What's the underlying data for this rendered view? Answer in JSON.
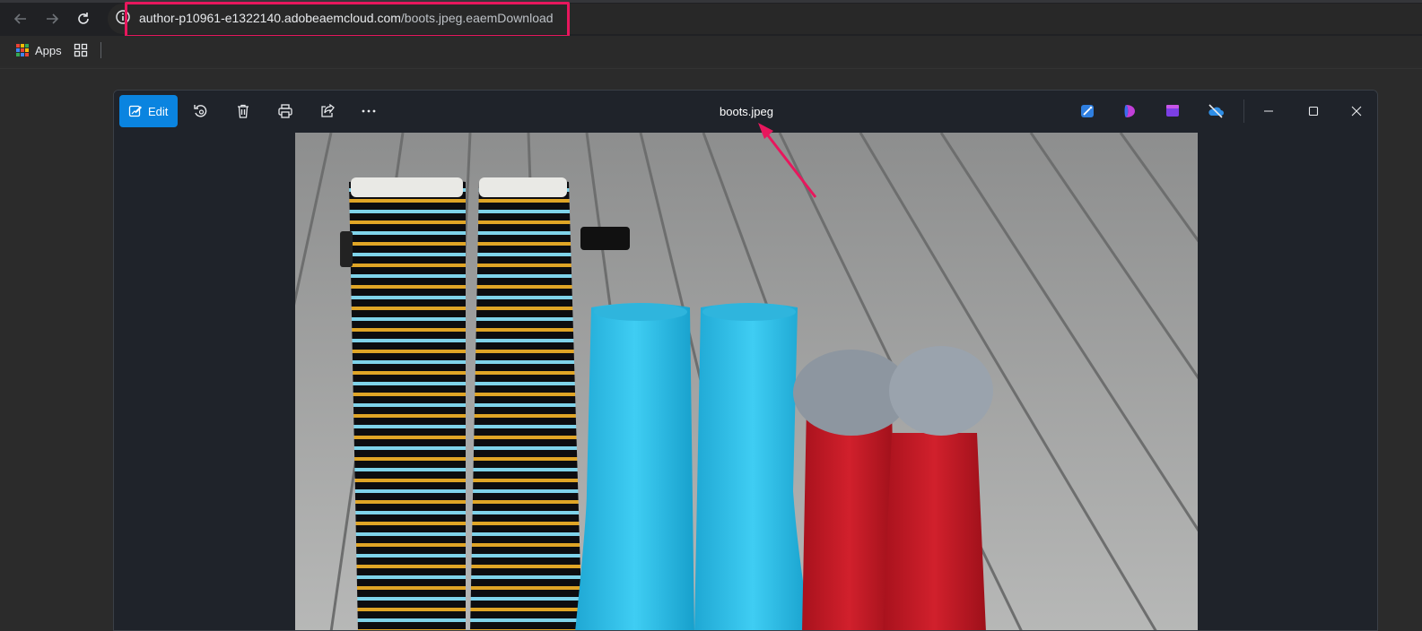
{
  "browser": {
    "url_host": "author-p10961-e1322140.adobeaemcloud.com",
    "url_path": "/boots.jpeg.eaemDownload",
    "bookmarks": {
      "apps_label": "Apps"
    }
  },
  "photos_app": {
    "edit_label": "Edit",
    "file_name": "boots.jpeg"
  },
  "colors": {
    "accent": "#0a84e0",
    "highlight": "#e8175d"
  },
  "icons": [
    "back-arrow-icon",
    "forward-arrow-icon",
    "reload-icon",
    "site-info-icon",
    "apps-grid-icon",
    "tab-groups-icon",
    "edit-image-icon",
    "rotate-icon",
    "trash-icon",
    "print-icon",
    "share-icon",
    "more-icon",
    "designer-icon",
    "copilot-icon",
    "clipchamp-icon",
    "onedrive-icon",
    "minimize-icon",
    "maximize-icon",
    "close-icon"
  ]
}
